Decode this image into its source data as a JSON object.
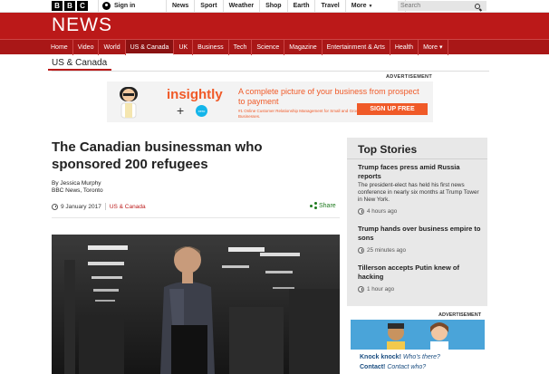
{
  "masthead": {
    "logo_letters": [
      "B",
      "B",
      "C"
    ],
    "signin_label": "Sign in",
    "nav": [
      "News",
      "Sport",
      "Weather",
      "Shop",
      "Earth",
      "Travel"
    ],
    "more_label": "More",
    "search_placeholder": "Search"
  },
  "header": {
    "title": "NEWS",
    "nav": [
      "Home",
      "Video",
      "World",
      "US & Canada",
      "UK",
      "Business",
      "Tech",
      "Science",
      "Magazine",
      "Entertainment & Arts",
      "Health",
      "More"
    ],
    "active_index": 3,
    "brand_color": "#bb1919"
  },
  "section": {
    "title": "US & Canada"
  },
  "advert_top": {
    "label": "ADVERTISEMENT",
    "brand": "insightly",
    "headline": "A complete picture of your business from prospect to payment",
    "subline": "#1 Online Customer Relationship Management for Small and Growing Businesses.",
    "cta": "SIGN UP FREE",
    "partner": "xero"
  },
  "article": {
    "headline": "The Canadian businessman who sponsored 200 refugees",
    "author": "By Jessica Murphy",
    "source": "BBC News, Toronto",
    "date": "9 January 2017",
    "section_link": "US & Canada",
    "share_label": "Share"
  },
  "top_stories": {
    "title": "Top Stories",
    "items": [
      {
        "headline": "Trump faces press amid Russia reports",
        "summary": "The president-elect has held his first news conference in nearly six months at Trump Tower in New York.",
        "time": "4 hours ago"
      },
      {
        "headline": "Trump hands over business empire to sons",
        "summary": "",
        "time": "25 minutes ago"
      },
      {
        "headline": "Tillerson accepts Putin knew of hacking",
        "summary": "",
        "time": "1 hour ago"
      }
    ]
  },
  "advert_side": {
    "label": "ADVERTISEMENT",
    "line1_bold": "Knock knock!",
    "line1_italic": "Who's there?",
    "line2_bold": "Contact!",
    "line2_italic": "Contact who?"
  }
}
